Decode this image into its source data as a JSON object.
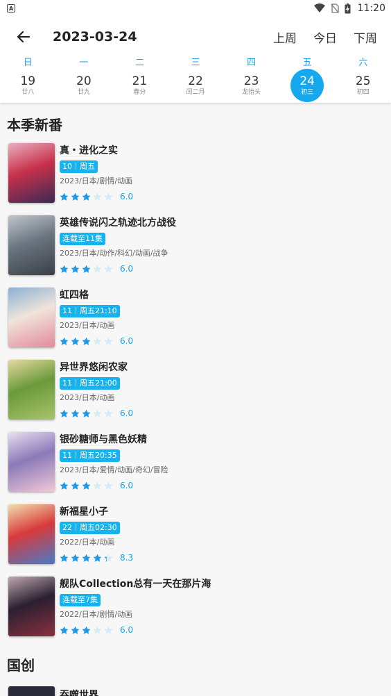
{
  "status_bar": {
    "time": "11:20",
    "left_icon": "A"
  },
  "header": {
    "date": "2023-03-24",
    "prev_week": "上周",
    "today": "今日",
    "next_week": "下周"
  },
  "week": [
    {
      "weekday": "日",
      "day": "19",
      "lunar": "廿八",
      "active": false
    },
    {
      "weekday": "一",
      "day": "20",
      "lunar": "廿九",
      "active": false
    },
    {
      "weekday": "二",
      "day": "21",
      "lunar": "春分",
      "active": false
    },
    {
      "weekday": "三",
      "day": "22",
      "lunar": "闰二月",
      "active": false
    },
    {
      "weekday": "四",
      "day": "23",
      "lunar": "龙抬头",
      "active": false
    },
    {
      "weekday": "五",
      "day": "24",
      "lunar": "初三",
      "active": true
    },
    {
      "weekday": "六",
      "day": "25",
      "lunar": "初四",
      "active": false
    }
  ],
  "sections": {
    "season_title": "本季新番",
    "domestic_title": "国创"
  },
  "anime": [
    {
      "title": "真・进化之实",
      "badge": "10｜周五",
      "meta": "2023/日本/剧情/动画",
      "stars": 3,
      "score": "6.0",
      "colors": [
        "#c8304a",
        "#3b2a55",
        "#e8b0c0"
      ]
    },
    {
      "title": "英雄传说闪之轨迹北方战役",
      "badge": "连载至11集",
      "meta": "2023/日本/动作/科幻/动画/战争",
      "stars": 3,
      "score": "6.0",
      "colors": [
        "#6b7580",
        "#3a3f45",
        "#c0c6cc"
      ]
    },
    {
      "title": "虹四格",
      "badge": "11｜周五21:10",
      "meta": "2023/日本/动画",
      "stars": 3,
      "score": "6.0",
      "colors": [
        "#f0e4da",
        "#e28a9c",
        "#8ab0d8"
      ]
    },
    {
      "title": "异世界悠闲农家",
      "badge": "11｜周五21:00",
      "meta": "2023/日本/动画",
      "stars": 3,
      "score": "6.0",
      "colors": [
        "#6a9a3a",
        "#a8c46a",
        "#e8d8a0"
      ]
    },
    {
      "title": "银砂糖师与黑色妖精",
      "badge": "11｜周五20:35",
      "meta": "2023/日本/爱情/动画/奇幻/冒险",
      "stars": 3,
      "score": "6.0",
      "colors": [
        "#8a7ab8",
        "#f2c8d8",
        "#e8e0f0"
      ]
    },
    {
      "title": "新福星小子",
      "badge": "22｜周五02:30",
      "meta": "2022/日本/动画",
      "stars": 4.3,
      "score": "8.3",
      "colors": [
        "#d83a3a",
        "#4a7ac8",
        "#f0e0b0"
      ]
    },
    {
      "title": "舰队Collection总有一天在那片海",
      "badge": "连载至7集",
      "meta": "2022/日本/剧情/动画",
      "stars": 3,
      "score": "6.0",
      "colors": [
        "#2a2030",
        "#8a3040",
        "#c0a8b0"
      ]
    }
  ],
  "next_item_partial": {
    "title": "吞噬世界"
  },
  "accent_color": "#15a8ee"
}
